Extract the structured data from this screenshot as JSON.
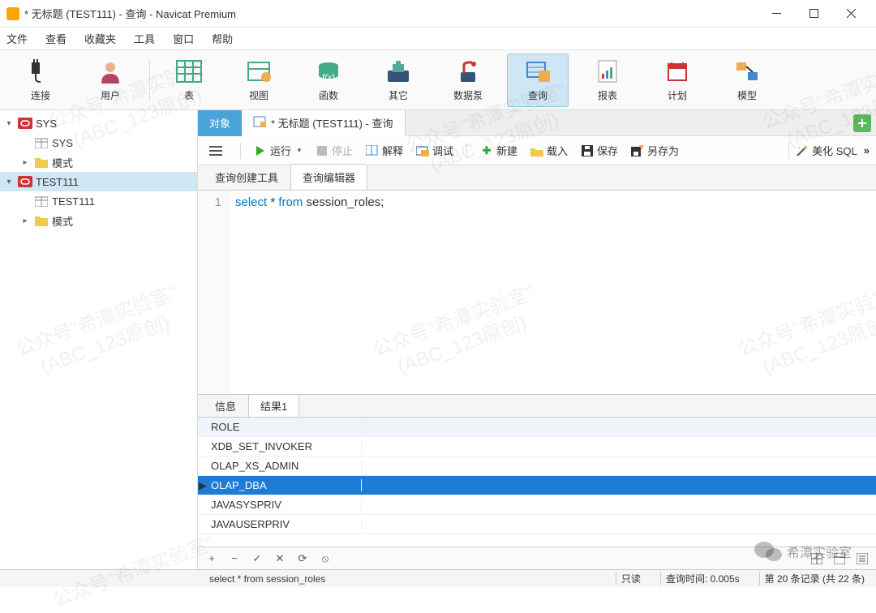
{
  "window": {
    "title": "* 无标题 (TEST111) - 查询 - Navicat Premium"
  },
  "menu": {
    "file": "文件",
    "view": "查看",
    "fav": "收藏夹",
    "tools": "工具",
    "window": "窗口",
    "help": "帮助"
  },
  "toolbar": {
    "connect": "连接",
    "user": "用户",
    "table": "表",
    "view": "视图",
    "func": "函数",
    "other": "其它",
    "datapump": "数据泵",
    "query": "查询",
    "report": "报表",
    "plan": "计划",
    "model": "模型"
  },
  "tree": {
    "items": [
      {
        "label": "SYS",
        "type": "db",
        "open": true
      },
      {
        "label": "SYS",
        "type": "schema"
      },
      {
        "label": "模式",
        "type": "folder",
        "expandable": true
      },
      {
        "label": "TEST111",
        "type": "db",
        "open": true,
        "selected": true
      },
      {
        "label": "TEST111",
        "type": "schema"
      },
      {
        "label": "模式",
        "type": "folder",
        "expandable": true
      }
    ]
  },
  "tabs1": {
    "objects": "对象",
    "query": "* 无标题 (TEST111) - 查询"
  },
  "qtoolbar": {
    "run": "运行",
    "stop": "停止",
    "explain": "解释",
    "debug": "调试",
    "new": "新建",
    "load": "载入",
    "save": "保存",
    "saveas": "另存为",
    "beautify": "美化 SQL"
  },
  "tabs2": {
    "builder": "查询创建工具",
    "editor": "查询编辑器"
  },
  "editor": {
    "line": "1",
    "kw1": "select",
    "star": " * ",
    "kw2": "from",
    "rest": " session_roles;"
  },
  "tabs3": {
    "info": "信息",
    "result": "结果1"
  },
  "grid": {
    "header": "ROLE",
    "rows": [
      "XDB_SET_INVOKER",
      "OLAP_XS_ADMIN",
      "OLAP_DBA",
      "JAVASYSPRIV",
      "JAVAUSERPRIV"
    ],
    "selected_index": 2
  },
  "status": {
    "sql": "select * from session_roles",
    "readonly": "只读",
    "time": "查询时间: 0.005s",
    "records": "第 20 条记录 (共 22 条)"
  },
  "watermark": {
    "line1": "公众号\"希潭实验室\"",
    "line2": "(ABC_123原创)"
  },
  "badge": "希潭实验室"
}
